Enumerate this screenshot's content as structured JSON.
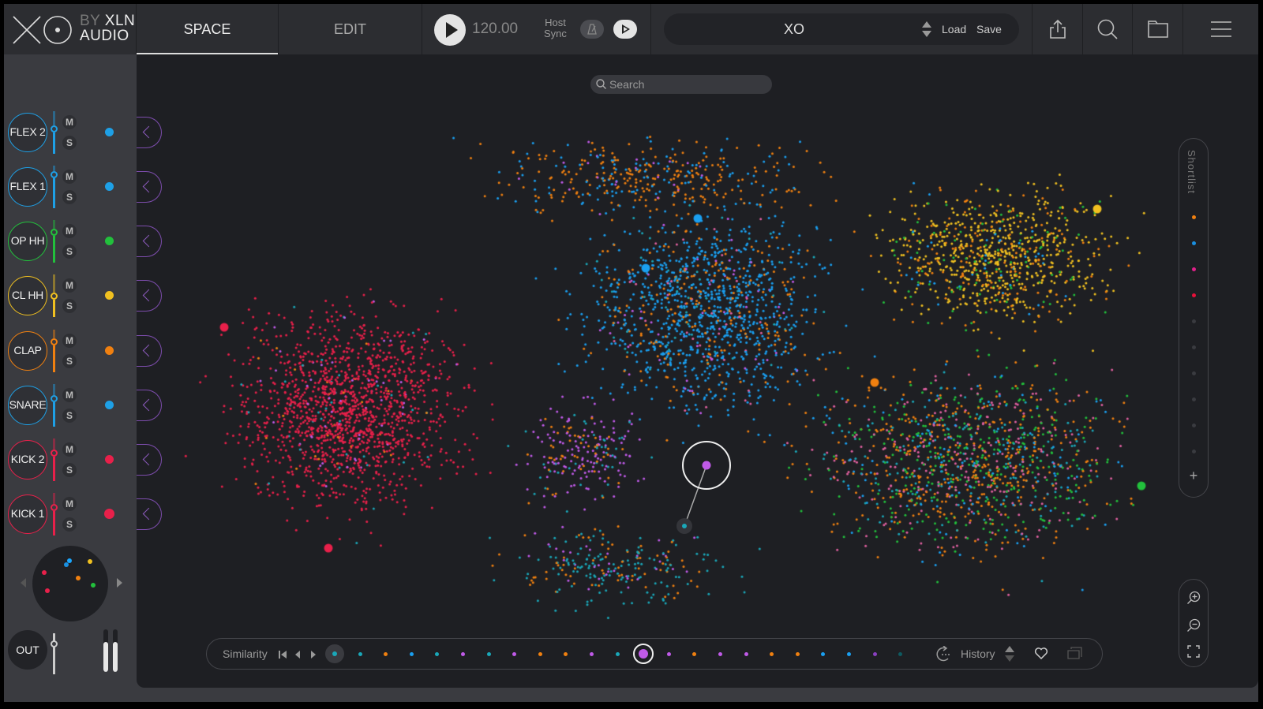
{
  "app": {
    "logo_by": "BY",
    "logo_brand": "XLN",
    "logo_sub": "AUDIO"
  },
  "tabs": [
    {
      "label": "SPACE",
      "active": true
    },
    {
      "label": "EDIT",
      "active": false
    }
  ],
  "transport": {
    "bpm": "120.00",
    "host_sync_line1": "Host",
    "host_sync_line2": "Sync"
  },
  "preset": {
    "name": "XO",
    "load_label": "Load",
    "save_label": "Save"
  },
  "toolbar_icons": [
    "export-icon",
    "search-icon",
    "folder-icon",
    "menu-icon"
  ],
  "channels": [
    {
      "label": "FLEX 2",
      "color": "#1ea0e6",
      "fader_level": 0.6
    },
    {
      "label": "FLEX 1",
      "color": "#1ea0e6",
      "fader_level": 0.85
    },
    {
      "label": "OP HH",
      "color": "#22c03c",
      "fader_level": 0.75
    },
    {
      "label": "CL HH",
      "color": "#f0c020",
      "fader_level": 0.5
    },
    {
      "label": "CLAP",
      "color": "#f08010",
      "fader_level": 0.75
    },
    {
      "label": "SNARE",
      "color": "#1ea0e6",
      "fader_level": 0.7
    },
    {
      "label": "KICK 2",
      "color": "#e8204a",
      "fader_level": 0.7
    },
    {
      "label": "KICK 1",
      "color": "#e8204a",
      "fader_level": 0.7
    }
  ],
  "mute_label": "M",
  "solo_label": "S",
  "output": {
    "label": "OUT",
    "fader_level": 0.8,
    "meter_left": 0.7,
    "meter_right": 0.7
  },
  "mini_map_dots": [
    {
      "color": "#1aa7ff"
    },
    {
      "color": "#1a8fe0"
    },
    {
      "color": "#f0c020"
    },
    {
      "color": "#e8204a"
    },
    {
      "color": "#f08010"
    },
    {
      "color": "#22c03c"
    },
    {
      "color": "#e8204a"
    }
  ],
  "space": {
    "search_placeholder": "Search",
    "cluster_colors": {
      "kick": "#e8204a",
      "snare": "#1a9ff0",
      "clap": "#f08010",
      "closed_hat": "#f0c020",
      "open_hat": "#22c03c",
      "perc": "#c05ae8",
      "tom": "#1aa7b8",
      "cymbal": "#e060a0"
    }
  },
  "shortlist": {
    "label": "Shortlist",
    "slots": [
      "#f08010",
      "#1a8fe0",
      "#e0208a",
      "#e8103a",
      null,
      null,
      null,
      null,
      null,
      null
    ],
    "add_label": "+"
  },
  "similarity": {
    "label": "Similarity",
    "dots": [
      "#1aa7b8",
      "#f08010",
      "#1a9ff0",
      "#1aa7b8",
      "#c05ae8",
      "#1aa7b8",
      "#c05ae8",
      "#f08010",
      "#f08010",
      "#c05ae8",
      "#1aa7b8",
      "SELECTED",
      "#c05ae8",
      "#f08010",
      "#c05ae8",
      "#c05ae8",
      "#f08010",
      "#f08010",
      "#1a9ff0",
      "#1a9ff0",
      "#8a40c0",
      "#0e5a60"
    ],
    "history_label": "History"
  }
}
